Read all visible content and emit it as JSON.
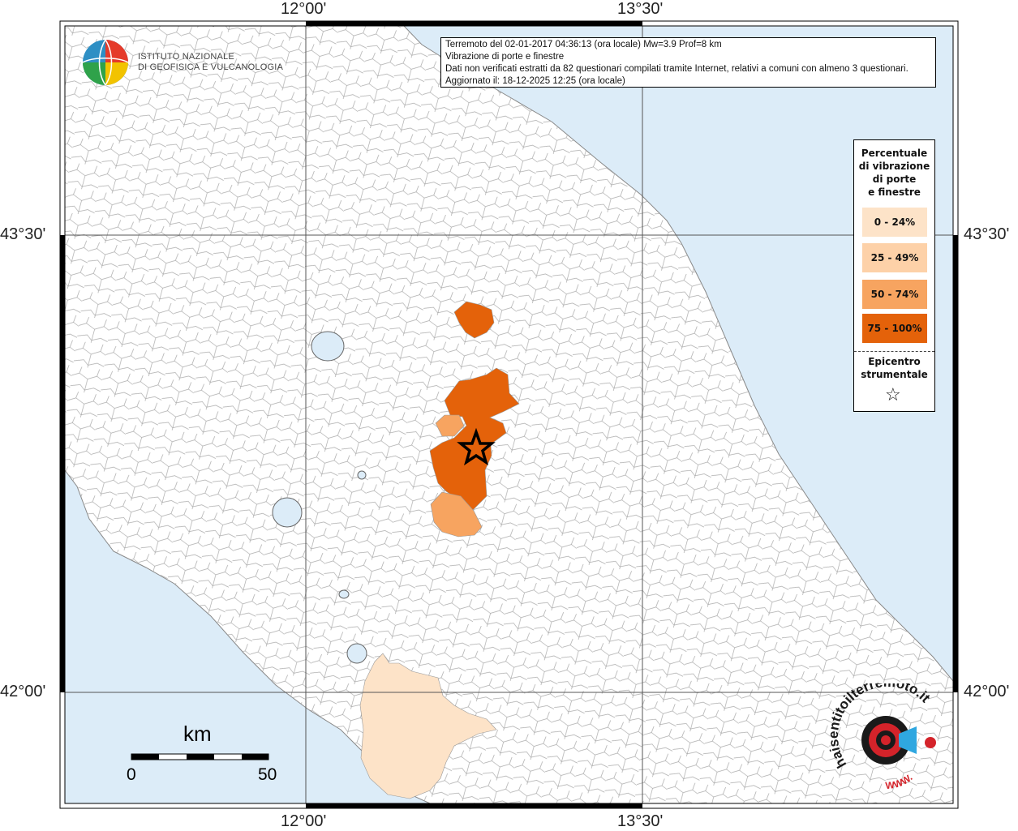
{
  "map": {
    "lon_labels": [
      "12°00'",
      "13°30'"
    ],
    "lat_labels": [
      "43°30'",
      "42°00'"
    ],
    "colors": {
      "sea": "#dcecf8",
      "land": "#ffffff",
      "border": "#999999",
      "grid": "#555555"
    }
  },
  "info": {
    "line1": "Terremoto del 02-01-2017 04:36:13 (ora locale) Mw=3.9 Prof=8 km",
    "line2": "Vibrazione di porte e finestre",
    "line3": "Dati non verificati estratti da 82 questionari compilati tramite Internet, relativi a comuni con almeno 3 questionari.",
    "line4": "Aggiornato il: 18-12-2025 12:25 (ora locale)"
  },
  "institute": {
    "line1": "Istituto Nazionale",
    "line2": "di Geofisica e Vulcanologia"
  },
  "legend": {
    "title": [
      "Percentuale",
      "di vibrazione",
      "di porte",
      "e finestre"
    ],
    "classes": [
      {
        "label": "0 - 24%",
        "color": "#fde3c8"
      },
      {
        "label": "25 - 49%",
        "color": "#fdd1a8"
      },
      {
        "label": "50 - 74%",
        "color": "#f7a460"
      },
      {
        "label": "75 - 100%",
        "color": "#e4620a"
      }
    ],
    "epicenter": [
      "Epicentro",
      "strumentale"
    ],
    "epicenter_symbol": "star-icon"
  },
  "scale": {
    "unit": "km",
    "min": "0",
    "max": "50"
  },
  "brand": {
    "text": "haisentitoilterremoto.it",
    "www": "WWW."
  }
}
